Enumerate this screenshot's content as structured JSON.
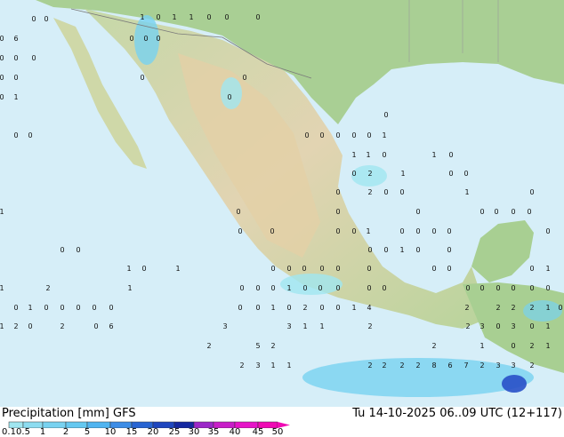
{
  "title": "Precipitation [mm]  GFS",
  "datetime": "Tu 14-10-2025 06..09 UTC (12+117)",
  "colorbar": {
    "labels": [
      "0.1",
      "0.5",
      "1",
      "2",
      "5",
      "10",
      "15",
      "20",
      "25",
      "30",
      "35",
      "40",
      "45",
      "50"
    ],
    "colors": [
      "#a0e6f0",
      "#8cdcf0",
      "#78d2f0",
      "#64c8f0",
      "#50b4f0",
      "#3c8ce6",
      "#2864d2",
      "#1e46be",
      "#1428a0",
      "#9c28c8",
      "#c81ec8",
      "#e614c8",
      "#f00ab4"
    ]
  },
  "values": [
    "0",
    "0",
    "1",
    "0",
    "1",
    "1",
    "0",
    "0",
    "0",
    "0",
    "6",
    "0",
    "0",
    "0",
    "0",
    "0",
    "0",
    "0",
    "0",
    "0",
    "0",
    "0",
    "1",
    "0",
    "0",
    "0",
    "0",
    "0",
    "0",
    "0",
    "0",
    "0",
    "1",
    "1",
    "1",
    "0",
    "1",
    "0",
    "0",
    "2",
    "1",
    "0",
    "0",
    "0",
    "2",
    "0",
    "0",
    "1",
    "0",
    "1",
    "0",
    "0",
    "0",
    "0",
    "0",
    "0",
    "0",
    "0",
    "0",
    "0",
    "0",
    "1",
    "0",
    "0",
    "0",
    "0",
    "0",
    "0",
    "0",
    "0",
    "0",
    "1",
    "0",
    "0",
    "1",
    "0",
    "1",
    "0",
    "0",
    "0",
    "0",
    "0",
    "0",
    "0",
    "0",
    "0",
    "1",
    "1",
    "2",
    "1",
    "0",
    "0",
    "0",
    "1",
    "0",
    "0",
    "0",
    "0",
    "0",
    "0",
    "0",
    "0",
    "0",
    "0",
    "0",
    "0",
    "1",
    "0",
    "0",
    "0",
    "0",
    "0",
    "0",
    "0",
    "1",
    "0",
    "2",
    "0",
    "0",
    "1",
    "4",
    "2",
    "2",
    "2",
    "2",
    "1",
    "0",
    "1",
    "2",
    "0",
    "2",
    "0",
    "6",
    "3",
    "3",
    "1",
    "1",
    "2",
    "2",
    "3",
    "0",
    "3",
    "0",
    "1",
    "2",
    "5",
    "2",
    "2",
    "1",
    "0",
    "2",
    "1",
    "2",
    "3",
    "1",
    "1",
    "2",
    "2",
    "2",
    "2",
    "8",
    "6",
    "7",
    "2",
    "3",
    "3",
    "2"
  ],
  "colors": {
    "ocean": "#d6eef8",
    "land": "#e9dcc0",
    "highland": "#dcc6a0",
    "lowland": "#a8cf92",
    "precip": "#78d2f0",
    "heavy": "#2850c8"
  }
}
